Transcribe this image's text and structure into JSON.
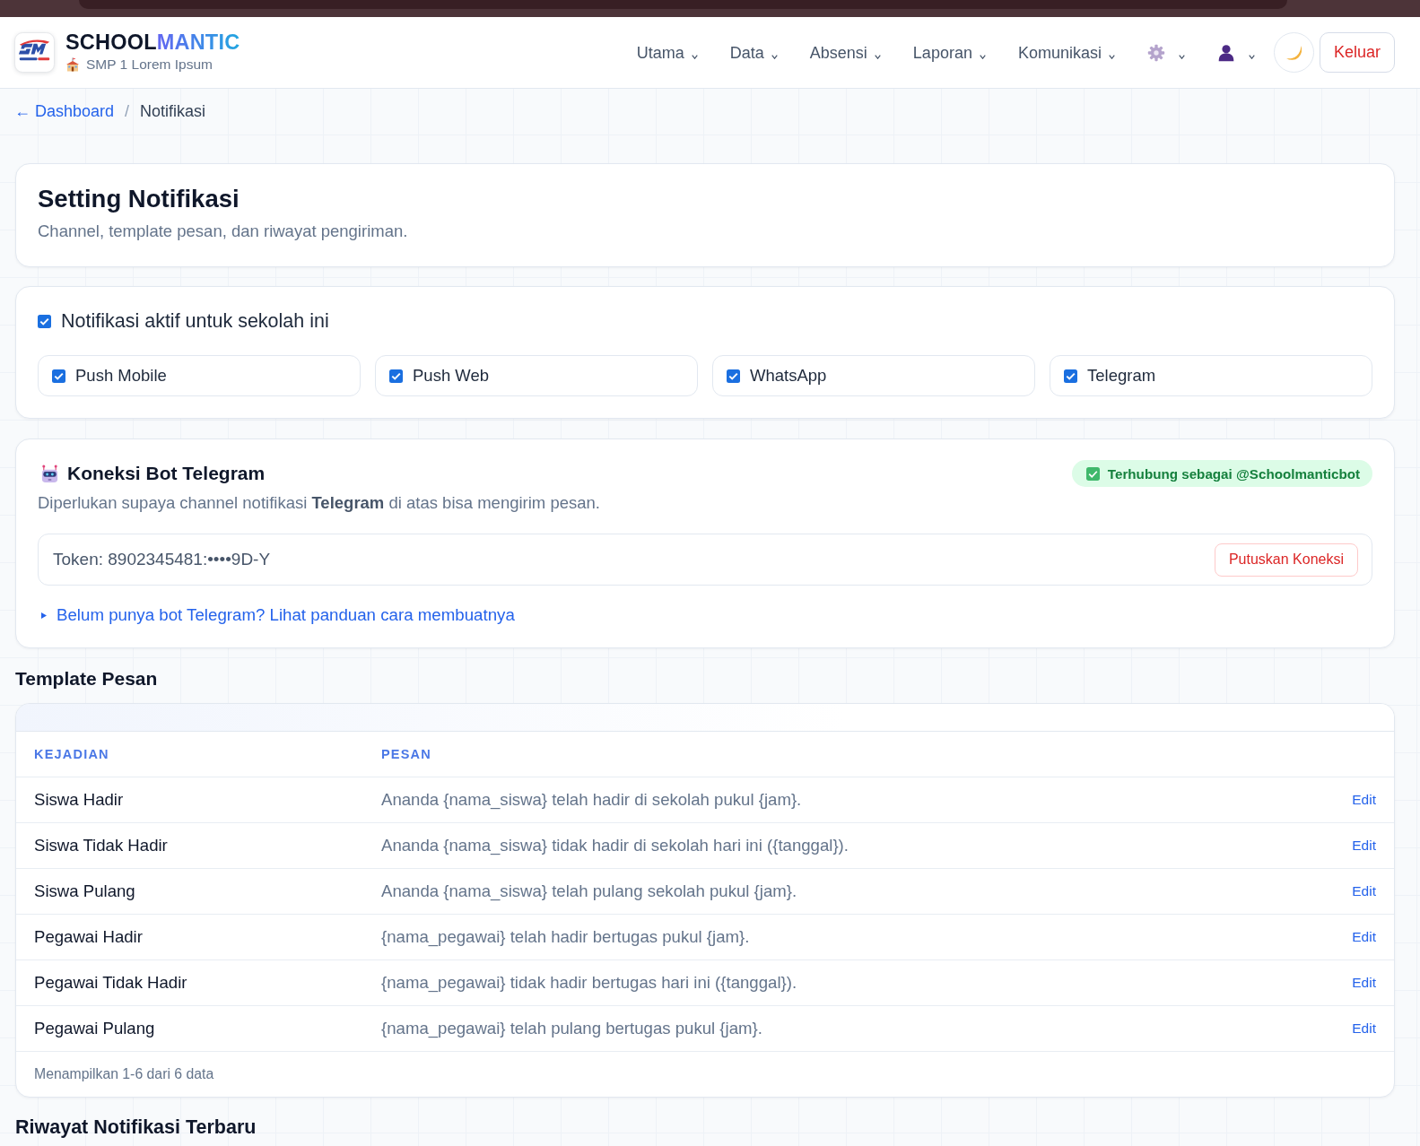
{
  "header": {
    "brand": {
      "primary": "SCHOOL",
      "accent": "MANTIC"
    },
    "school": "SMP 1 Lorem Ipsum",
    "nav": [
      {
        "kind": "text",
        "label": "Utama"
      },
      {
        "kind": "text",
        "label": "Data"
      },
      {
        "kind": "text",
        "label": "Absensi"
      },
      {
        "kind": "text",
        "label": "Laporan"
      },
      {
        "kind": "text",
        "label": "Komunikasi"
      },
      {
        "kind": "settings"
      },
      {
        "kind": "account"
      }
    ],
    "logout": "Keluar"
  },
  "breadcrumb": {
    "back": "← Dashboard",
    "separator": "/",
    "current": "Notifikasi"
  },
  "page_header": {
    "title": "Setting Notifikasi",
    "subtitle": "Channel, template pesan, dan riwayat pengiriman."
  },
  "notification_settings": {
    "master": {
      "label": "Notifikasi aktif untuk sekolah ini",
      "checked": true
    },
    "channels": [
      {
        "label": "Push Mobile",
        "checked": true
      },
      {
        "label": "Push Web",
        "checked": true
      },
      {
        "label": "WhatsApp",
        "checked": true
      },
      {
        "label": "Telegram",
        "checked": true
      }
    ]
  },
  "telegram_bot": {
    "title": "Koneksi Bot Telegram",
    "status": "Terhubung sebagai @Schoolmanticbot",
    "description": "Diperlukan supaya channel notifikasi **Telegram** di atas bisa mengirim pesan.",
    "token": "Token: 8902345481:••••9D-Y",
    "disconnect_button": "Putuskan Koneksi",
    "guide": {
      "label": "Belum punya bot Telegram? Lihat panduan cara membuatnya",
      "expanded": false
    }
  },
  "templates": {
    "title": "Template Pesan",
    "columns": [
      "KEJADIAN",
      "PESAN"
    ],
    "rows": [
      {
        "event": "Siswa Hadir",
        "message": "Ananda {nama_siswa} telah hadir di sekolah pukul {jam}.",
        "action": "Edit"
      },
      {
        "event": "Siswa Tidak Hadir",
        "message": "Ananda {nama_siswa} tidak hadir di sekolah hari ini ({tanggal}).",
        "action": "Edit"
      },
      {
        "event": "Siswa Pulang",
        "message": "Ananda {nama_siswa} telah pulang sekolah pukul {jam}.",
        "action": "Edit"
      },
      {
        "event": "Pegawai Hadir",
        "message": "{nama_pegawai} telah hadir bertugas pukul {jam}.",
        "action": "Edit"
      },
      {
        "event": "Pegawai Tidak Hadir",
        "message": "{nama_pegawai} tidak hadir bertugas hari ini ({tanggal}).",
        "action": "Edit"
      },
      {
        "event": "Pegawai Pulang",
        "message": "{nama_pegawai} telah pulang bertugas pukul {jam}.",
        "action": "Edit"
      }
    ],
    "footer": "Menampilkan 1-6 dari 6 data"
  },
  "history": {
    "title": "Riwayat Notifikasi Terbaru"
  }
}
